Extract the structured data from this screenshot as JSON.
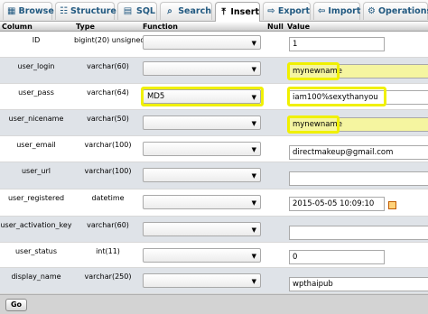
{
  "tabs": [
    {
      "label": "Browse",
      "icon": "browse-icon"
    },
    {
      "label": "Structure",
      "icon": "structure-icon"
    },
    {
      "label": "SQL",
      "icon": "sql-icon"
    },
    {
      "label": "Search",
      "icon": "search-icon"
    },
    {
      "label": "Insert",
      "icon": "insert-icon",
      "active": true
    },
    {
      "label": "Export",
      "icon": "export-icon"
    },
    {
      "label": "Import",
      "icon": "import-icon"
    },
    {
      "label": "Operations",
      "icon": "operations-icon"
    }
  ],
  "header": {
    "column": "Column",
    "type": "Type",
    "function": "Function",
    "null": "Null",
    "value": "Value"
  },
  "rows": [
    {
      "name": "ID",
      "type": "bigint(20) unsigned",
      "function": "",
      "value": "1"
    },
    {
      "name": "user_login",
      "type": "varchar(60)",
      "function": "",
      "value": "mynewname"
    },
    {
      "name": "user_pass",
      "type": "varchar(64)",
      "function": "MD5",
      "value": "iam100%sexythanyou"
    },
    {
      "name": "user_nicename",
      "type": "varchar(50)",
      "function": "",
      "value": "mynewname"
    },
    {
      "name": "user_email",
      "type": "varchar(100)",
      "function": "",
      "value": "directmakeup@gmail.com"
    },
    {
      "name": "user_url",
      "type": "varchar(100)",
      "function": "",
      "value": ""
    },
    {
      "name": "user_registered",
      "type": "datetime",
      "function": "",
      "value": "2015-05-05 10:09:10"
    },
    {
      "name": "user_activation_key",
      "type": "varchar(60)",
      "function": "",
      "value": ""
    },
    {
      "name": "user_status",
      "type": "int(11)",
      "function": "",
      "value": "0"
    },
    {
      "name": "display_name",
      "type": "varchar(250)",
      "function": "",
      "value": "wpthaipub"
    }
  ],
  "go_label": "Go",
  "colors": {
    "highlight": "#f0f000",
    "row_alt": "#dfe3e8",
    "tab_text": "#235a81"
  }
}
